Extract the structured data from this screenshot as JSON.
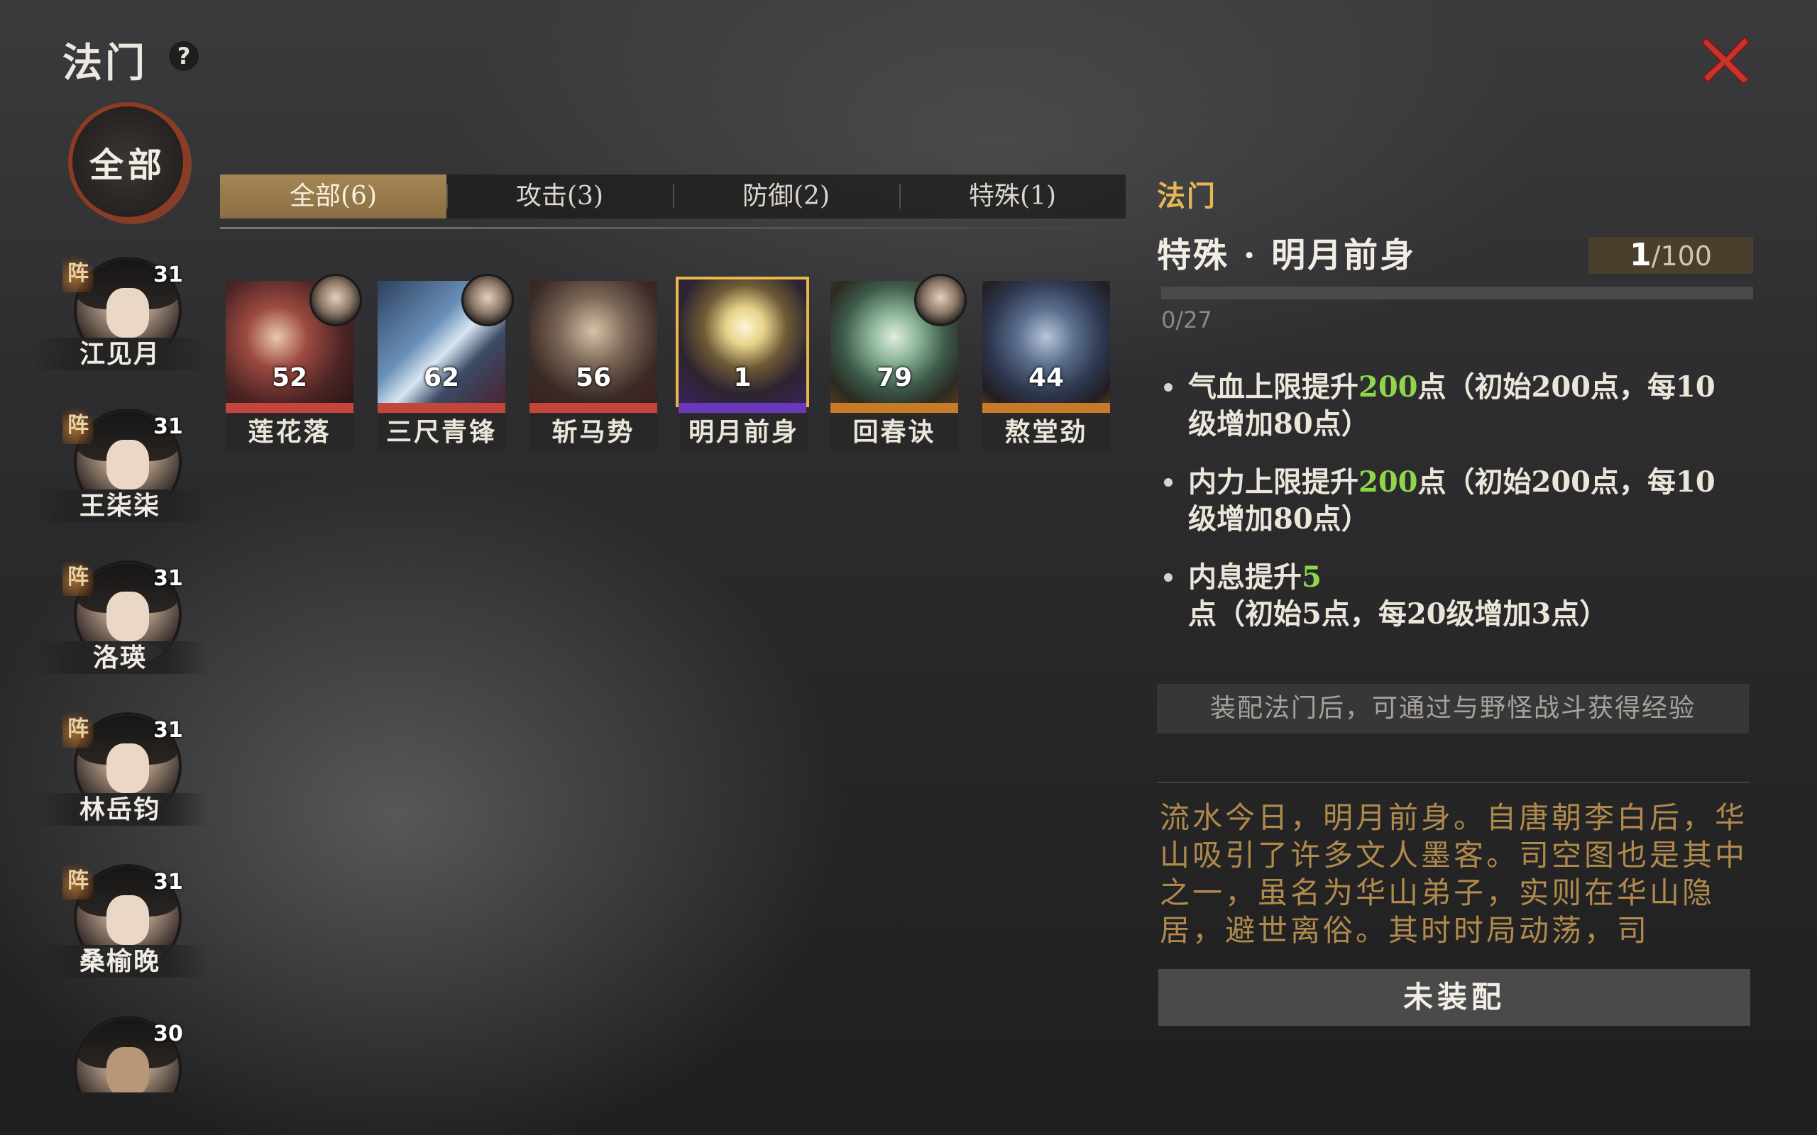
{
  "header": {
    "title": "法门",
    "help_label": "?"
  },
  "filter": {
    "all_label": "全部"
  },
  "roster": [
    {
      "name": "江见月",
      "level": "31",
      "badge": "阵"
    },
    {
      "name": "王柒柒",
      "level": "31",
      "badge": "阵"
    },
    {
      "name": "洛瑛",
      "level": "31",
      "badge": "阵"
    },
    {
      "name": "林岳钧",
      "level": "31",
      "badge": "阵"
    },
    {
      "name": "桑榆晚",
      "level": "31",
      "badge": "阵"
    },
    {
      "name": "",
      "level": "30",
      "badge": ""
    }
  ],
  "tabs": [
    {
      "label": "全部(6)",
      "active": true
    },
    {
      "label": "攻击(3)",
      "active": false
    },
    {
      "label": "防御(2)",
      "active": false
    },
    {
      "label": "特殊(1)",
      "active": false
    }
  ],
  "skills": [
    {
      "name": "莲花落",
      "count": "52",
      "tier": "red",
      "equipped": true
    },
    {
      "name": "三尺青锋",
      "count": "62",
      "tier": "red",
      "equipped": true
    },
    {
      "name": "斩马势",
      "count": "56",
      "tier": "red",
      "equipped": false
    },
    {
      "name": "明月前身",
      "count": "1",
      "tier": "purple",
      "equipped": false,
      "selected": true
    },
    {
      "name": "回春诀",
      "count": "79",
      "tier": "orange",
      "equipped": true
    },
    {
      "name": "熬堂劲",
      "count": "44",
      "tier": "orange",
      "equipped": false
    }
  ],
  "detail": {
    "section_label": "法门",
    "title": "特殊 · 明月前身",
    "level_current": "1",
    "level_max": "/100",
    "xp_text": "0/27",
    "xp_progress": 0,
    "effects": [
      {
        "pre": "气血上限提升",
        "value": "200",
        "post": "点（初始200点，每10级增加80点）"
      },
      {
        "pre": "内力上限提升",
        "value": "200",
        "post": "点（初始200点，每10级增加80点）"
      },
      {
        "pre": "内息提升",
        "value": "5",
        "post": "点（初始5点，每20级增加3点）"
      }
    ],
    "notice": "装配法门后，可通过与野怪战斗获得经验",
    "description": "流水今日，明月前身。自唐朝李白后，华山吸引了许多文人墨客。司空图也是其中之一，虽名为华山弟子，实则在华山隐居，避世离俗。其时时局动荡，司",
    "equip_label": "未装配"
  },
  "colors": {
    "accent_gold": "#e7b654",
    "highlight_green": "#8fd64a",
    "tab_active": "#a48654",
    "close_red": "#c8332c"
  }
}
